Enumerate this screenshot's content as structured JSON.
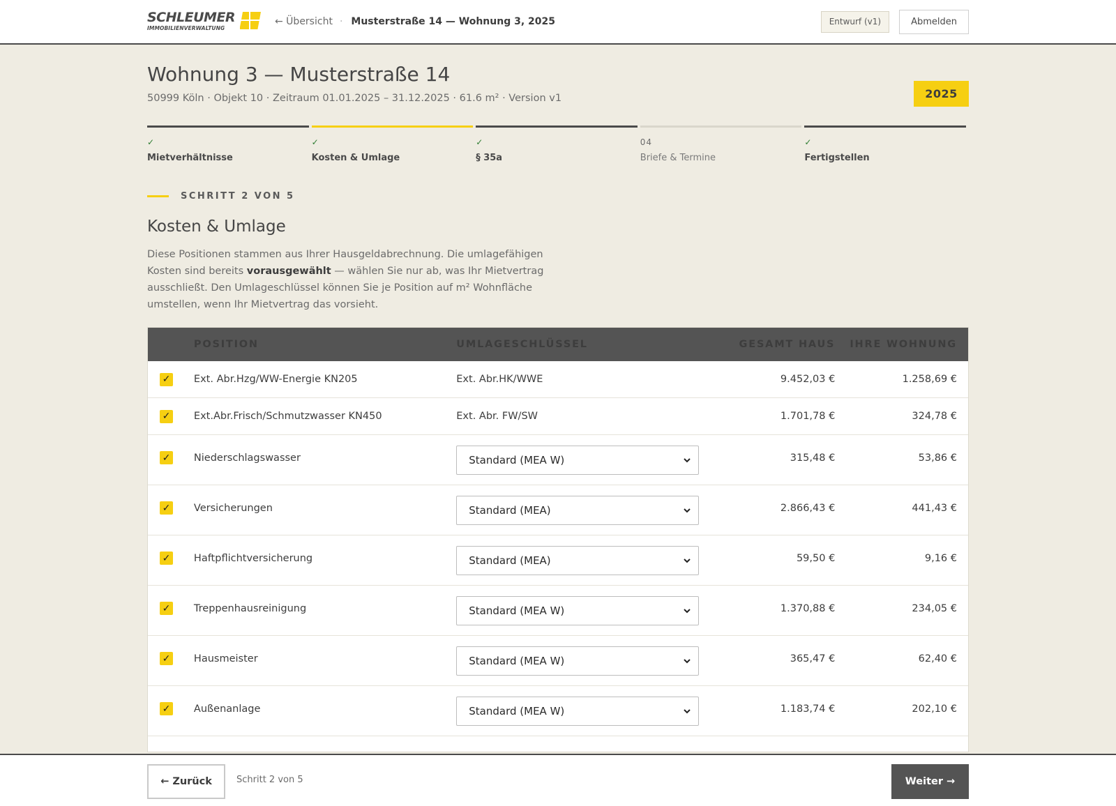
{
  "header": {
    "logo_word": "SCHLEUMER",
    "logo_sub": "IMMOBILIENVERWALTUNG",
    "back_link": "← Übersicht",
    "separator": "·",
    "current": "Musterstraße 14 — Wohnung 3, 2025",
    "draft_badge": "Entwurf (v1)",
    "logout": "Abmelden",
    "brand_yellow": "#f6cf12"
  },
  "page": {
    "title": "Wohnung 3 — Musterstraße 14",
    "meta": "50999 Köln · Objekt 10 · Zeitraum 01.01.2025 – 31.12.2025 · 61.6 m² · Version v1",
    "year": "2025"
  },
  "stepper": [
    {
      "mark": "✓",
      "label": "Mietverhältnisse",
      "state": "done"
    },
    {
      "mark": "✓",
      "label": "Kosten & Umlage",
      "state": "active"
    },
    {
      "mark": "✓",
      "label": "§ 35a",
      "state": "done"
    },
    {
      "mark": "04",
      "label": "Briefe & Termine",
      "state": "pending"
    },
    {
      "mark": "✓",
      "label": "Fertigstellen",
      "state": "done"
    }
  ],
  "section": {
    "kicker": "SCHRITT 2 VON 5",
    "title": "Kosten & Umlage",
    "desc_1": "Diese Positionen stammen aus Ihrer Hausgeldabrechnung. Die umlagefähigen Kosten sind bereits ",
    "desc_bold": "vorausgewählt",
    "desc_2": " — wählen Sie nur ab, was Ihr Mietvertrag ausschließt. Den Umlageschlüssel können Sie je Position auf m² Wohnfläche umstellen, wenn Ihr Mietvertrag das vorsieht."
  },
  "table": {
    "headers": {
      "position": "POSITION",
      "key": "UMLAGESCHLÜSSEL",
      "total": "GESAMT HAUS",
      "own": "IHRE WOHNUNG"
    },
    "rows": [
      {
        "checked": true,
        "position": "Ext. Abr.Hzg/WW-Energie KN205",
        "key": "Ext. Abr.HK/WWE",
        "total": "9.452,03 €",
        "own": "1.258,69 €"
      },
      {
        "checked": true,
        "position": "Ext.Abr.Frisch/Schmutzwasser KN450",
        "key": "Ext. Abr. FW/SW",
        "total": "1.701,78 €",
        "own": "324,78 €"
      },
      {
        "checked": true,
        "position": "Niederschlagswasser",
        "select": "Standard (MEA W)",
        "total": "315,48 €",
        "own": "53,86 €"
      },
      {
        "checked": true,
        "position": "Versicherungen",
        "select": "Standard (MEA)",
        "total": "2.866,43 €",
        "own": "441,43 €"
      },
      {
        "checked": true,
        "position": "Haftpflichtversicherung",
        "select": "Standard (MEA)",
        "total": "59,50 €",
        "own": "9,16 €"
      },
      {
        "checked": true,
        "position": "Treppenhausreinigung",
        "select": "Standard (MEA W)",
        "total": "1.370,88 €",
        "own": "234,05 €"
      },
      {
        "checked": true,
        "position": "Hausmeister",
        "select": "Standard (MEA W)",
        "total": "365,47 €",
        "own": "62,40 €"
      },
      {
        "checked": true,
        "position": "Außenanlage",
        "select": "Standard (MEA W)",
        "total": "1.183,74 €",
        "own": "202,10 €"
      }
    ]
  },
  "footer": {
    "back": "← Zurück",
    "step": "Schritt 2 von 5",
    "next": "Weiter →"
  }
}
